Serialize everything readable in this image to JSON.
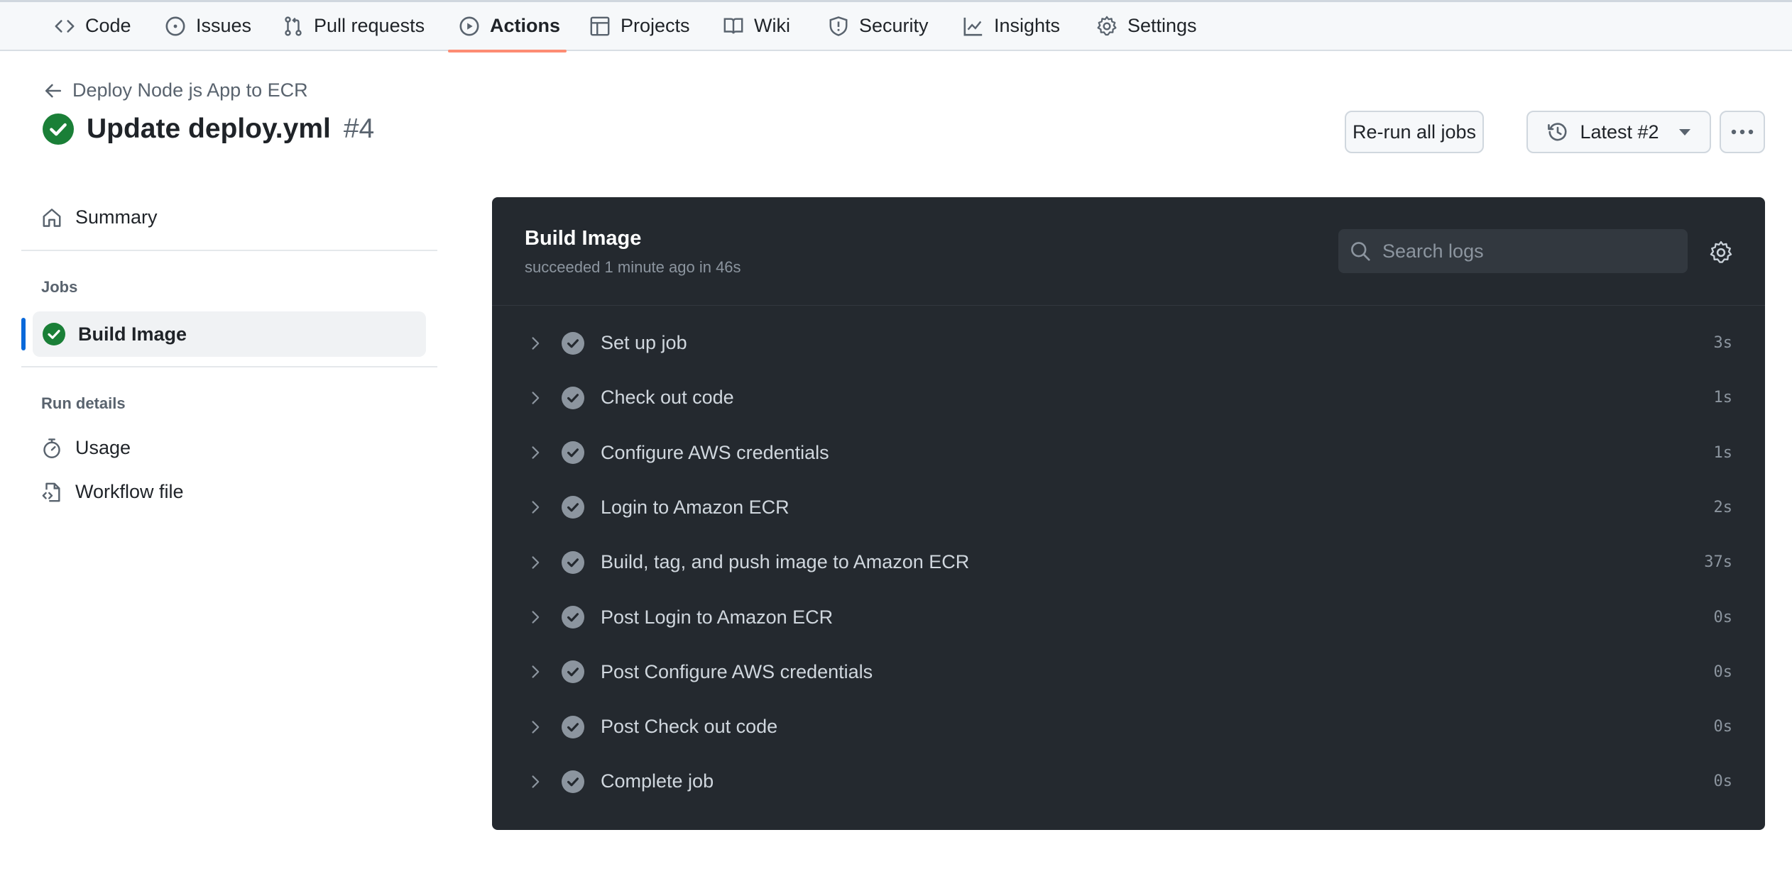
{
  "repo_nav": {
    "items": [
      {
        "label": "Code",
        "icon": "code-icon"
      },
      {
        "label": "Issues",
        "icon": "issue-opened-icon"
      },
      {
        "label": "Pull requests",
        "icon": "git-pull-request-icon"
      },
      {
        "label": "Actions",
        "icon": "play-icon",
        "active": true
      },
      {
        "label": "Projects",
        "icon": "table-icon"
      },
      {
        "label": "Wiki",
        "icon": "book-icon"
      },
      {
        "label": "Security",
        "icon": "shield-icon"
      },
      {
        "label": "Insights",
        "icon": "graph-icon"
      },
      {
        "label": "Settings",
        "icon": "gear-icon"
      }
    ],
    "active_color": "#fd8c73"
  },
  "header": {
    "back_link": "Deploy Node js App to ECR",
    "title": "Update deploy.yml",
    "run_number": "#4",
    "status": "success",
    "status_color": "#1a7f37"
  },
  "actions": {
    "rerun_label": "Re-run all jobs",
    "attempt_label": "Latest #2",
    "more_icon": "kebab-horizontal-icon"
  },
  "sidebar": {
    "summary_label": "Summary",
    "jobs_heading": "Jobs",
    "jobs": [
      {
        "label": "Build Image",
        "status": "success",
        "selected": true
      }
    ],
    "run_details_heading": "Run details",
    "run_details": [
      {
        "label": "Usage",
        "icon": "stopwatch-icon"
      },
      {
        "label": "Workflow file",
        "icon": "file-code-icon"
      }
    ],
    "selected_indicator_color": "#0969da"
  },
  "log_panel": {
    "title": "Build Image",
    "subtitle": "succeeded 1 minute ago in 46s",
    "search_placeholder": "Search logs",
    "steps": [
      {
        "name": "Set up job",
        "duration": "3s"
      },
      {
        "name": "Check out code",
        "duration": "1s"
      },
      {
        "name": "Configure AWS credentials",
        "duration": "1s"
      },
      {
        "name": "Login to Amazon ECR",
        "duration": "2s"
      },
      {
        "name": "Build, tag, and push image to Amazon ECR",
        "duration": "37s"
      },
      {
        "name": "Post Login to Amazon ECR",
        "duration": "0s"
      },
      {
        "name": "Post Configure AWS credentials",
        "duration": "0s"
      },
      {
        "name": "Post Check out code",
        "duration": "0s"
      },
      {
        "name": "Complete job",
        "duration": "0s"
      }
    ]
  }
}
